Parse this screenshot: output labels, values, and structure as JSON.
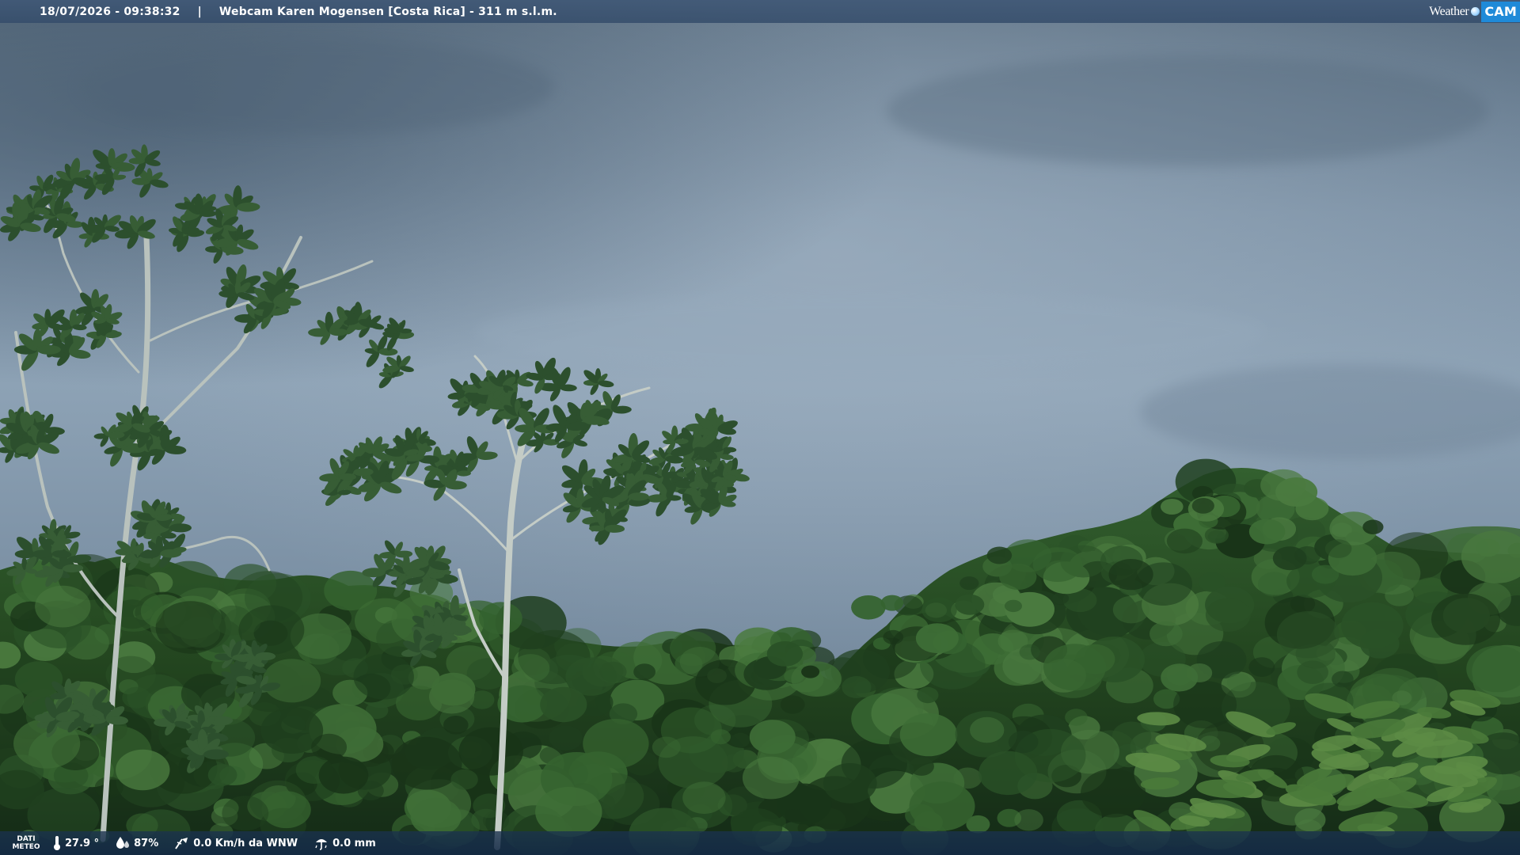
{
  "overlay": {
    "timestamp": "18/07/2026 - 09:38:32",
    "separator": "|",
    "title": "Webcam Karen Mogensen [Costa Rica] - 311 m s.l.m.",
    "logo": {
      "weather": "Weather",
      "cam": "CAM"
    }
  },
  "meteo": {
    "label_line1": "DATI",
    "label_line2": "METEO",
    "temperature": "27.9 °",
    "humidity": "87%",
    "wind": "0.0 Km/h da WNW",
    "rain": "0.0 mm"
  },
  "icons": {
    "temperature": "thermometer-icon",
    "humidity": "humidity-drop-icon",
    "wind": "wind-icon",
    "rain": "rain-gauge-icon"
  },
  "colors": {
    "sky_top": "#5d7285",
    "sky_mid": "#8ea3b6",
    "sky_low": "#7b8fa2",
    "foliage_dark": "#17301c",
    "foliage_mid": "#2f5a2c",
    "foliage_light": "#4f7f3e",
    "logo_accent": "#1f8ad8"
  }
}
